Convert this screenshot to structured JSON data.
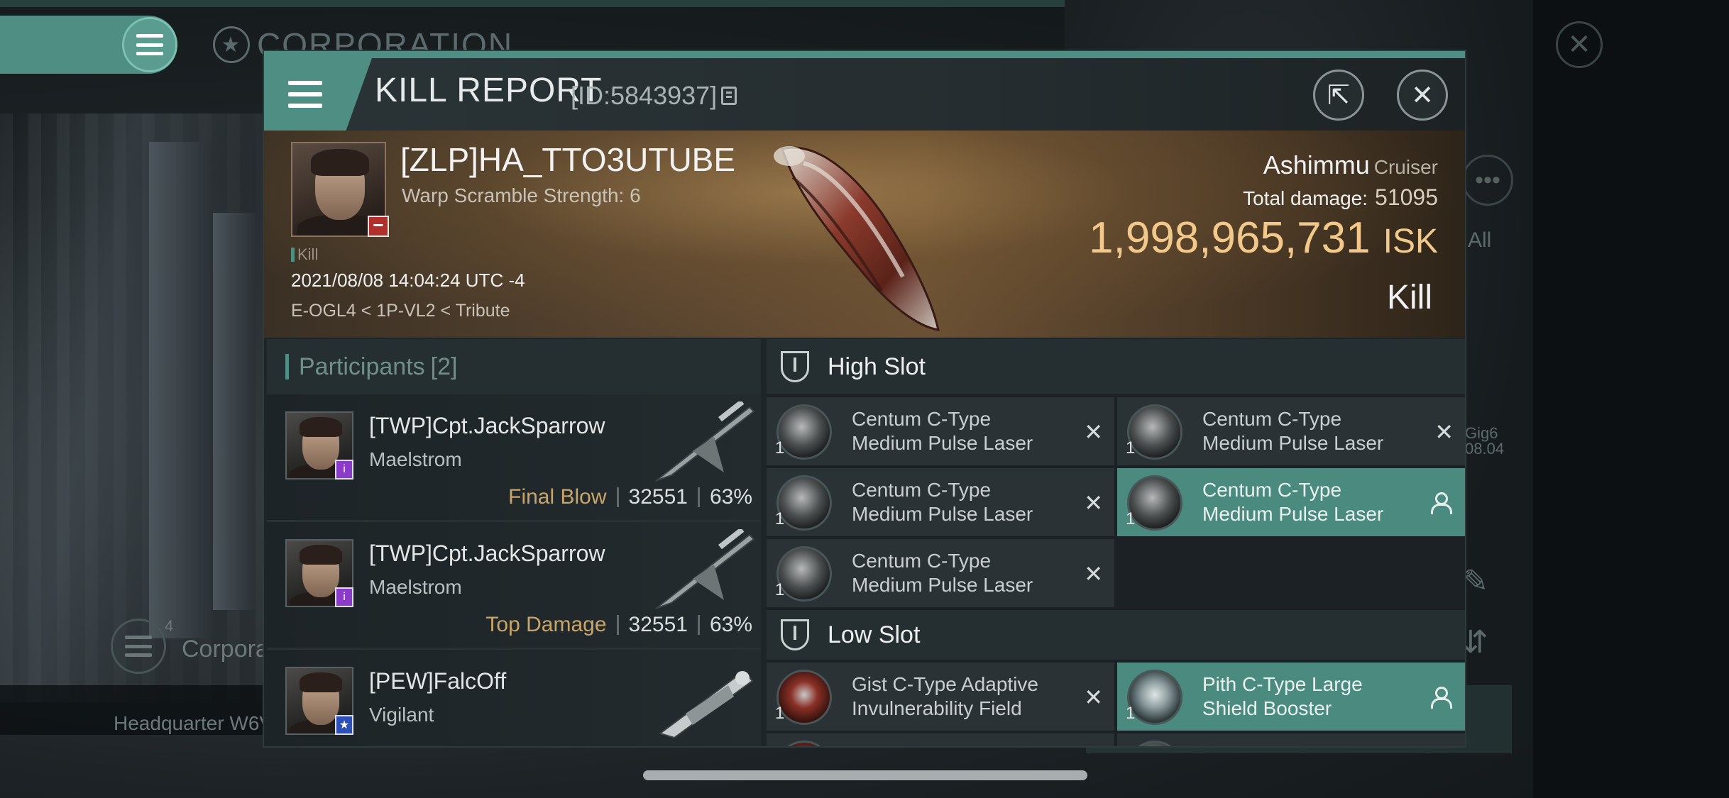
{
  "background": {
    "corp_title": "CORPORATION",
    "right_more_icon": "ellipsis-icon",
    "right_all_label": "All",
    "right_gig_line1": "Gig6",
    "right_gig_line2": "08.04",
    "corp_count": "4",
    "corp_label": "Corpora",
    "hq_label": "Headquarter W6V"
  },
  "kill_report": {
    "title": "KILL REPORT",
    "id_label": "[ID:5843937]",
    "victim": {
      "name": "[ZLP]HA_TTO3UTUBE",
      "warp_scramble": "Warp Scramble Strength: 6",
      "kill_tag": "Kill",
      "timestamp": "2021/08/08 14:04:24 UTC -4",
      "location": "E-OGL4 < 1P-VL2 < Tribute",
      "ship_name": "Ashimmu",
      "ship_class": "Cruiser",
      "total_damage_label": "Total damage:",
      "total_damage": "51095",
      "isk_value": "1,998,965,731",
      "isk_label": "ISK",
      "result": "Kill"
    },
    "participants": {
      "label": "Participants",
      "count": "[2]",
      "rows": [
        {
          "name": "[TWP]Cpt.JackSparrow",
          "ship": "Maelstrom",
          "role": "Final Blow",
          "damage": "32551",
          "percent": "63%"
        },
        {
          "name": "[TWP]Cpt.JackSparrow",
          "ship": "Maelstrom",
          "role": "Top Damage",
          "damage": "32551",
          "percent": "63%"
        },
        {
          "name": "[PEW]FalcOff",
          "ship": "Vigilant",
          "role": "",
          "damage": "",
          "percent": ""
        }
      ]
    },
    "high_slot": {
      "label": "High Slot",
      "modules": [
        {
          "qty": "1",
          "name_line1": "Centum C-Type",
          "name_line2": "Medium Pulse Laser",
          "status": "destroyed"
        },
        {
          "qty": "1",
          "name_line1": "Centum C-Type",
          "name_line2": "Medium Pulse Laser",
          "status": "destroyed"
        },
        {
          "qty": "1",
          "name_line1": "Centum C-Type",
          "name_line2": "Medium Pulse Laser",
          "status": "destroyed"
        },
        {
          "qty": "1",
          "name_line1": "Centum C-Type",
          "name_line2": "Medium Pulse Laser",
          "status": "dropped"
        },
        {
          "qty": "1",
          "name_line1": "Centum C-Type",
          "name_line2": "Medium Pulse Laser",
          "status": "destroyed"
        }
      ]
    },
    "low_slot": {
      "label": "Low Slot",
      "modules": [
        {
          "qty": "1",
          "name_line1": "Gist C-Type Adaptive",
          "name_line2": "Invulnerability Field",
          "status": "destroyed"
        },
        {
          "qty": "1",
          "name_line1": "Pith C-Type Large",
          "name_line2": "Shield Booster",
          "status": "dropped"
        }
      ]
    },
    "icons": {
      "menu": "hamburger-icon",
      "copy": "copy-icon",
      "share": "share-icon",
      "close": "close-icon",
      "destroyed": "x-icon",
      "dropped": "person-icon"
    },
    "colors": {
      "accent": "#4f8f83",
      "isk": "#f2c98a",
      "role": "#c9a569",
      "dropped_bg": "#4a8a7f"
    }
  }
}
